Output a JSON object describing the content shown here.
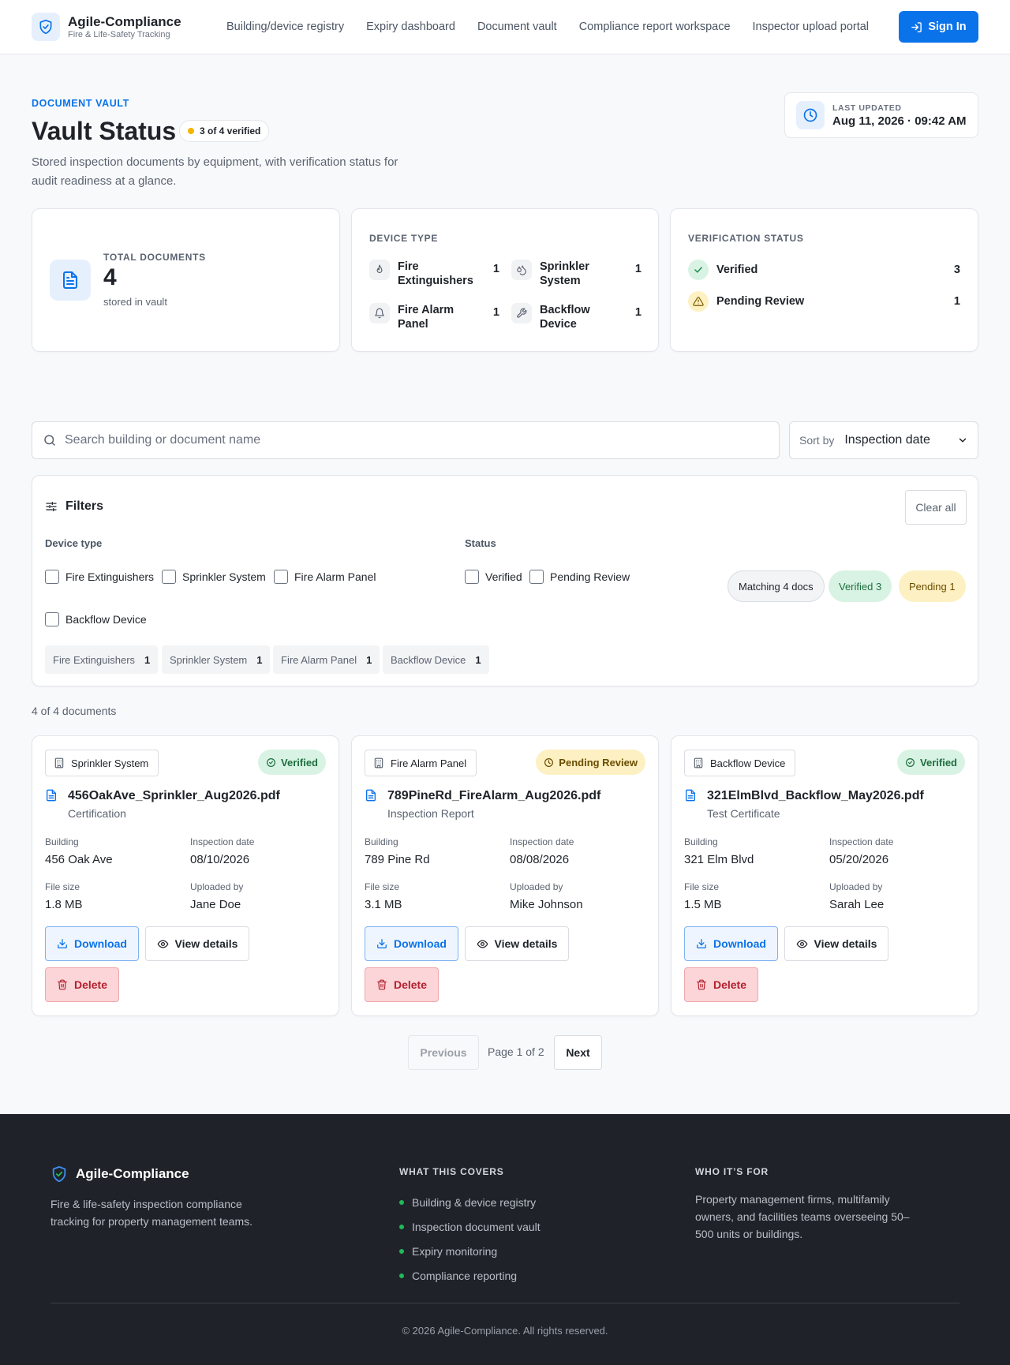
{
  "header": {
    "brand_name": "Agile-Compliance",
    "brand_sub": "Fire & Life-Safety Tracking",
    "nav": [
      "Building/device registry",
      "Expiry dashboard",
      "Document vault",
      "Compliance report workspace",
      "Inspector upload portal"
    ],
    "signin_label": "Sign In",
    "accent": "#0a73ea"
  },
  "hero": {
    "eyebrow": "DOCUMENT VAULT",
    "title": "Vault Status",
    "verified_pill": "3 of 4 verified",
    "lede": "Stored inspection documents by equipment, with verification status for audit readiness at a glance.",
    "updated_label": "LAST UPDATED",
    "updated_value": "Aug 11, 2026 · 09:42 AM"
  },
  "stats": {
    "total_label": "TOTAL DOCUMENTS",
    "total_value": "4",
    "total_sub": "stored in vault",
    "device_label": "DEVICE TYPE",
    "devices": [
      {
        "name": "Fire Extinguishers",
        "count": "1",
        "icon": "flame-icon"
      },
      {
        "name": "Sprinkler System",
        "count": "1",
        "icon": "droplets-icon"
      },
      {
        "name": "Fire Alarm Panel",
        "count": "1",
        "icon": "bell-icon"
      },
      {
        "name": "Backflow Device",
        "count": "1",
        "icon": "wrench-icon"
      }
    ],
    "verification_label": "VERIFICATION STATUS",
    "verification": [
      {
        "name": "Verified",
        "count": "3",
        "icon": "check-icon"
      },
      {
        "name": "Pending Review",
        "count": "1",
        "icon": "warning-icon"
      }
    ]
  },
  "search": {
    "placeholder": "Search building or document name",
    "sort_label": "Sort by",
    "sort_value": "Inspection date"
  },
  "filters": {
    "title": "Filters",
    "clear_label": "Clear all",
    "device_label": "Device type",
    "device_options": [
      "Fire Extinguishers",
      "Sprinkler System",
      "Fire Alarm Panel",
      "Backflow Device"
    ],
    "status_label": "Status",
    "status_options": [
      "Verified",
      "Pending Review"
    ],
    "pills": {
      "matching": "Matching 4 docs",
      "verified": "Verified 3",
      "pending": "Pending 1"
    },
    "chips": [
      {
        "label": "Fire Extinguishers",
        "count": "1"
      },
      {
        "label": "Sprinkler System",
        "count": "1"
      },
      {
        "label": "Fire Alarm Panel",
        "count": "1"
      },
      {
        "label": "Backflow Device",
        "count": "1"
      }
    ]
  },
  "results": {
    "count_text": "4 of 4 documents",
    "labels": {
      "building": "Building",
      "inspection_date": "Inspection date",
      "file_size": "File size",
      "uploaded_by": "Uploaded by",
      "download": "Download",
      "view": "View details",
      "delete": "Delete"
    },
    "docs": [
      {
        "device": "Sprinkler System",
        "status": "Verified",
        "file": "456OakAve_Sprinkler_Aug2026.pdf",
        "type": "Certification",
        "building": "456 Oak Ave",
        "date": "08/10/2026",
        "size": "1.8 MB",
        "uploader": "Jane Doe"
      },
      {
        "device": "Fire Alarm Panel",
        "status": "Pending Review",
        "file": "789PineRd_FireAlarm_Aug2026.pdf",
        "type": "Inspection Report",
        "building": "789 Pine Rd",
        "date": "08/08/2026",
        "size": "3.1 MB",
        "uploader": "Mike Johnson"
      },
      {
        "device": "Backflow Device",
        "status": "Verified",
        "file": "321ElmBlvd_Backflow_May2026.pdf",
        "type": "Test Certificate",
        "building": "321 Elm Blvd",
        "date": "05/20/2026",
        "size": "1.5 MB",
        "uploader": "Sarah Lee"
      }
    ]
  },
  "pagination": {
    "prev": "Previous",
    "info": "Page 1 of 2",
    "next": "Next"
  },
  "footer": {
    "brand": "Agile-Compliance",
    "desc": "Fire & life-safety inspection compliance tracking for property management teams.",
    "covers_title": "WHAT THIS COVERS",
    "covers": [
      "Building & device registry",
      "Inspection document vault",
      "Expiry monitoring",
      "Compliance reporting"
    ],
    "who_title": "WHO IT’S FOR",
    "who": "Property management firms, multifamily owners, and facilities teams overseeing 50–500 units or buildings.",
    "copyright": "© 2026 Agile-Compliance. All rights reserved."
  }
}
